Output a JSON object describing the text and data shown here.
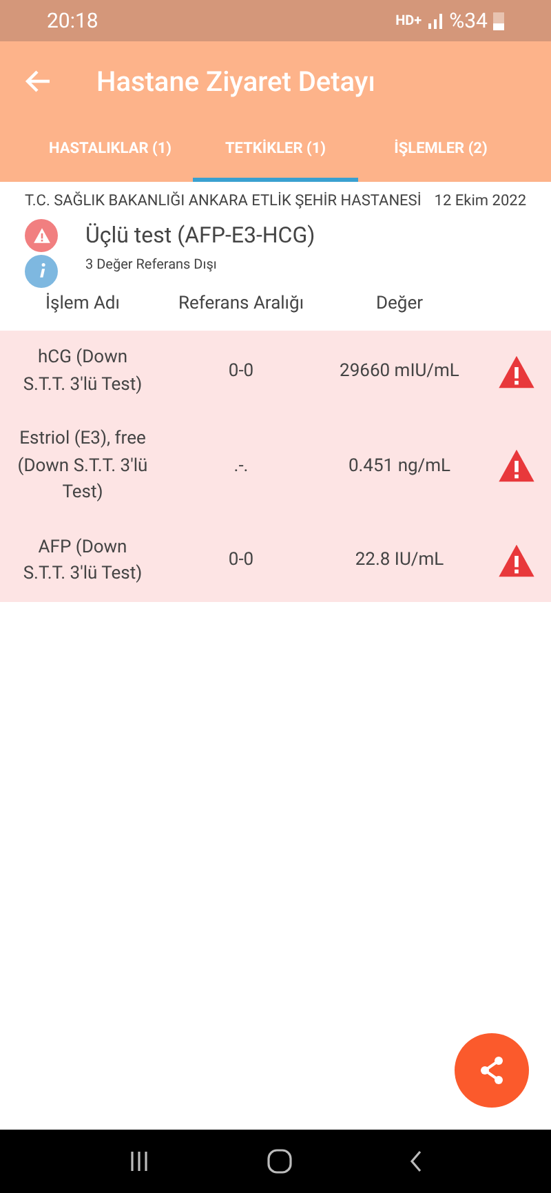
{
  "status_bar": {
    "time": "20:18",
    "network": "HD+",
    "battery": "%34"
  },
  "app_bar": {
    "title": "Hastane Ziyaret Detayı"
  },
  "tabs": [
    {
      "label": "HASTALIKLAR (1)",
      "selected": false
    },
    {
      "label": "TETKİKLER (1)",
      "selected": true
    },
    {
      "label": "İŞLEMLER (2)",
      "selected": false
    }
  ],
  "hospital": "T.C. SAĞLIK BAKANLIĞI ANKARA ETLİK ŞEHİR HASTANESİ",
  "date": "12 Ekim 2022",
  "test_name": "Üçlü test (AFP-E3-HCG)",
  "info": "3 Değer Referans Dışı",
  "table": {
    "columns": [
      "İşlem Adı",
      "Referans Aralığı",
      "Değer"
    ],
    "rows": [
      {
        "name": "hCG (Down S.T.T. 3'lü Test)",
        "range": "0-0",
        "value": "29660 mIU/mL",
        "out_of_range": true
      },
      {
        "name": "Estriol (E3), free (Down S.T.T. 3'lü Test)",
        "range": ".-.",
        "value": "0.451 ng/mL",
        "out_of_range": true
      },
      {
        "name": "AFP (Down S.T.T. 3'lü Test)",
        "range": "0-0",
        "value": "22.8 IU/mL",
        "out_of_range": true
      }
    ]
  }
}
